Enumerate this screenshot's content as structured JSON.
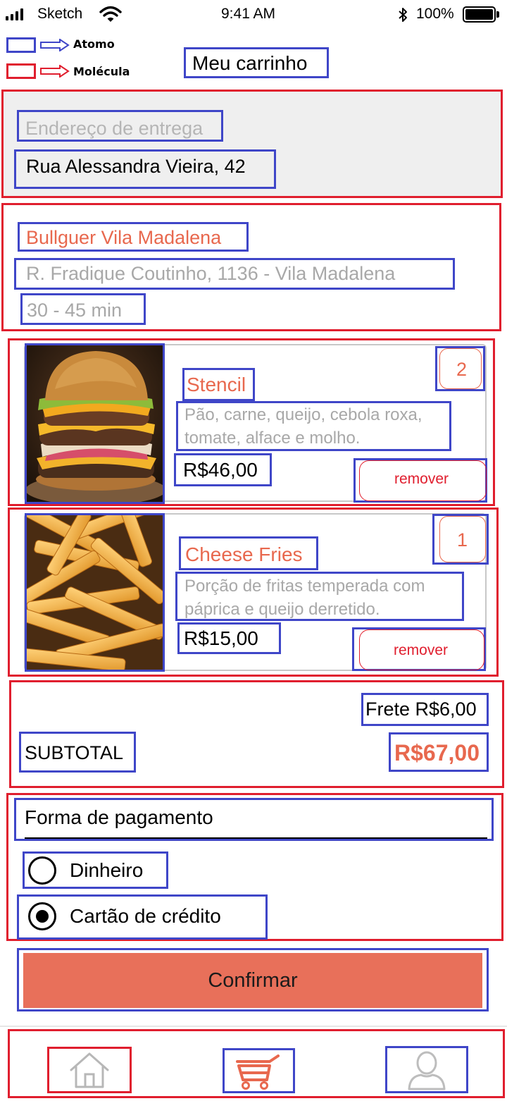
{
  "status_bar": {
    "carrier": "Sketch",
    "time": "9:41 AM",
    "battery": "100%"
  },
  "legend": {
    "atom_label": "Atomo",
    "molecule_label": "Molécula"
  },
  "header": {
    "title": "Meu carrinho"
  },
  "delivery": {
    "placeholder": "Endereço de entrega",
    "address": "Rua Alessandra Vieira, 42"
  },
  "restaurant": {
    "name": "Bullguer Vila Madalena",
    "address": "R. Fradique Coutinho, 1136 - Vila Madalena",
    "eta": "30 - 45 min"
  },
  "cart": {
    "items": [
      {
        "name": "Stencil",
        "description_line1": "Pão, carne, queijo, cebola roxa,",
        "description_line2": "tomate, alface e molho.",
        "price": "R$46,00",
        "quantity": "2",
        "remove_label": "remover",
        "image_icon": "burger-photo"
      },
      {
        "name": "Cheese Fries",
        "description_line1": "Porção de fritas temperada com",
        "description_line2": "páprica e queijo derretido.",
        "price": "R$15,00",
        "quantity": "1",
        "remove_label": "remover",
        "image_icon": "fries-photo"
      }
    ]
  },
  "summary": {
    "shipping": "Frete R$6,00",
    "subtotal_label": "SUBTOTAL",
    "subtotal_value": "R$67,00"
  },
  "payment": {
    "title": "Forma de pagamento",
    "options": [
      {
        "label": "Dinheiro",
        "selected": false
      },
      {
        "label": "Cartão de crédito",
        "selected": true
      }
    ]
  },
  "confirm_label": "Confirmar",
  "nav": {
    "items": [
      {
        "icon": "home-icon",
        "active": false
      },
      {
        "icon": "cart-icon",
        "active": true
      },
      {
        "icon": "profile-icon",
        "active": false
      }
    ]
  },
  "colors": {
    "atom_border": "#3f46c8",
    "molecule_border": "#e01e2e",
    "accent": "#e8684e",
    "confirm_bg": "#e8705a",
    "delivery_bg": "#efefef"
  }
}
